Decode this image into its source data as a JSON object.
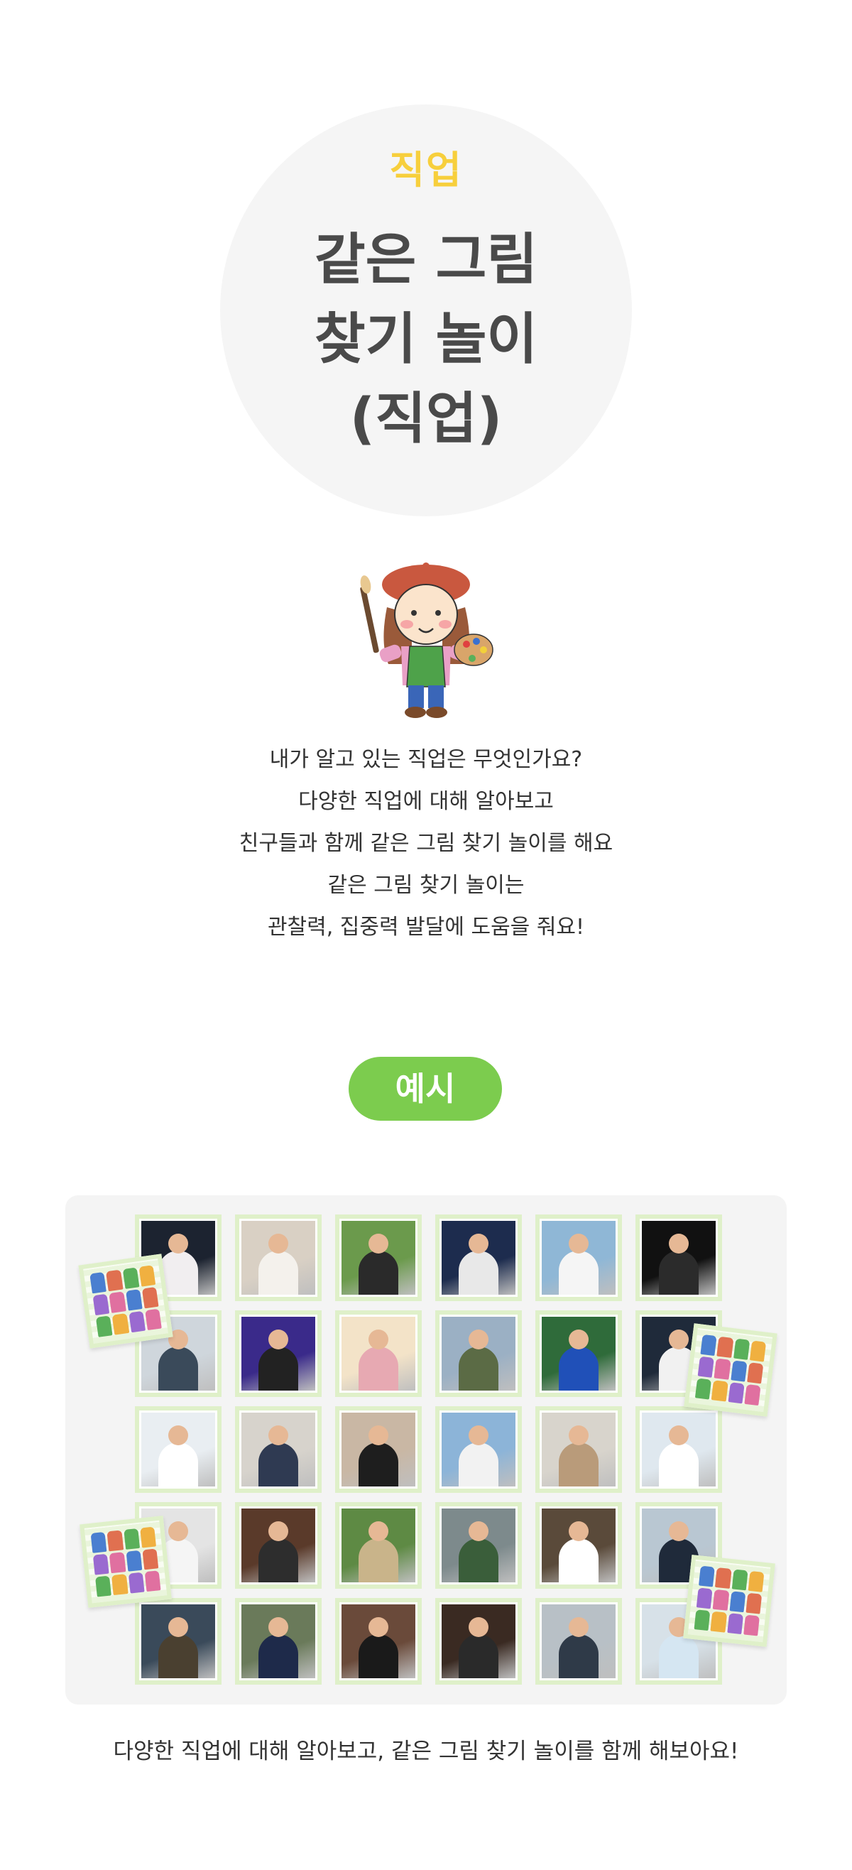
{
  "hero": {
    "category": "직업",
    "title_lines": [
      "같은 그림",
      "찾기 놀이",
      "(직업)"
    ]
  },
  "illustration": {
    "icon": "painter-girl-icon"
  },
  "description": [
    "내가 알고 있는 직업은 무엇인가요?",
    "다양한 직업에 대해 알아보고",
    "친구들과 함께 같은 그림 찾기 놀이를 해요",
    "같은 그림 찾기 놀이는",
    "관찰력, 집중력 발달에 도움을 줘요!"
  ],
  "example_label": "예시",
  "caption": "다양한 직업에 대해 알아보고, 같은 그림 찾기 놀이를 함께 해보아요!",
  "colors": {
    "accent_yellow": "#f7cf3c",
    "accent_green": "#7ccc4e",
    "card_border": "#dff0c9"
  },
  "cards": [
    {
      "name": "ballerina",
      "bg": "#1c2330",
      "fig": "#f1eef0"
    },
    {
      "name": "painter",
      "bg": "#d9d0c4",
      "fig": "#f4f1ec"
    },
    {
      "name": "photographer",
      "bg": "#6b9a4c",
      "fig": "#2a2a2a"
    },
    {
      "name": "astronaut",
      "bg": "#1d2c4e",
      "fig": "#e8e8e8"
    },
    {
      "name": "ship-captain",
      "bg": "#8fb7d6",
      "fig": "#f5f5f5"
    },
    {
      "name": "magician",
      "bg": "#111111",
      "fig": "#2b2b2b"
    },
    {
      "name": "station-worker",
      "bg": "#cfd6dc",
      "fig": "#3a4a5a"
    },
    {
      "name": "singer",
      "bg": "#3a2a8a",
      "fig": "#222222"
    },
    {
      "name": "teacher",
      "bg": "#f3e3c8",
      "fig": "#e7a9b2"
    },
    {
      "name": "soldier",
      "bg": "#9bb0c4",
      "fig": "#5b6b45"
    },
    {
      "name": "soccer-player",
      "bg": "#2f6b3a",
      "fig": "#2050b8"
    },
    {
      "name": "baseball-player",
      "bg": "#1f2a3a",
      "fig": "#f1f1f1"
    },
    {
      "name": "veterinarian",
      "bg": "#e9eef2",
      "fig": "#ffffff"
    },
    {
      "name": "courier",
      "bg": "#d7d3cc",
      "fig": "#2f3a52"
    },
    {
      "name": "hairdresser",
      "bg": "#c9b7a4",
      "fig": "#1e1e1e"
    },
    {
      "name": "pilot",
      "bg": "#8cb4d8",
      "fig": "#f2f2f2"
    },
    {
      "name": "flight-attendant",
      "bg": "#d8d4cc",
      "fig": "#b99b7a"
    },
    {
      "name": "scientist",
      "bg": "#dfe8ef",
      "fig": "#ffffff"
    },
    {
      "name": "doctor",
      "bg": "#e4e4e4",
      "fig": "#f5f5f5"
    },
    {
      "name": "firefighter",
      "bg": "#5a3a2a",
      "fig": "#2d2d2d"
    },
    {
      "name": "farmer",
      "bg": "#5e8a44",
      "fig": "#c9b48a"
    },
    {
      "name": "sanitation-worker",
      "bg": "#7d8a8c",
      "fig": "#3a5e3a"
    },
    {
      "name": "chef",
      "bg": "#5a4a3a",
      "fig": "#ffffff"
    },
    {
      "name": "security-guard",
      "bg": "#b9c7d2",
      "fig": "#1f2a3a"
    },
    {
      "name": "fisherman",
      "bg": "#3a4a5a",
      "fig": "#4a4030"
    },
    {
      "name": "postal-worker",
      "bg": "#6a7a5a",
      "fig": "#1e2a4a"
    },
    {
      "name": "judge",
      "bg": "#6a4a3a",
      "fig": "#1a1a1a"
    },
    {
      "name": "barista",
      "bg": "#3a2a22",
      "fig": "#2a2a2a"
    },
    {
      "name": "police-officer",
      "bg": "#b8c0c6",
      "fig": "#2f3a48"
    },
    {
      "name": "nurse",
      "bg": "#d7e1e8",
      "fig": "#d5e6f2"
    }
  ],
  "back_cards": [
    {
      "name": "card-back-1"
    },
    {
      "name": "card-back-2"
    },
    {
      "name": "card-back-3"
    },
    {
      "name": "card-back-4"
    }
  ]
}
